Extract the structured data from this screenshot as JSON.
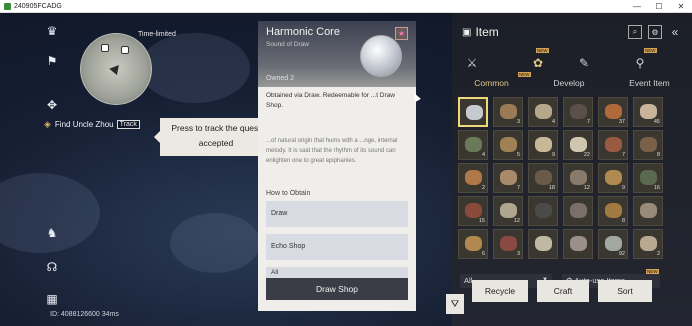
{
  "window": {
    "title": "240905FCADG",
    "min": "—",
    "max": "☐",
    "close": "✕"
  },
  "hud": {
    "time_limited": "Time-limited",
    "quest_name": "Find Uncle Zhou",
    "track_label": "Track",
    "tooltip": "Press to track the quest accepted",
    "id_text": "ID: 4088126600",
    "ping_text": "34ms"
  },
  "item_card": {
    "name": "Harmonic Core",
    "subtitle": "Sound of Draw",
    "owned": "Owned 2",
    "description": "Obtained via Draw. Redeemable for ...t Draw Shop.",
    "lore": "...of natural origin that hums with a ...nge, internal melody. It is said that the rhythm of its sound can enlighten one to great epiphanies.",
    "how_to_obtain": "How to Obtain",
    "sources": [
      "Draw",
      "Echo Shop",
      "All"
    ],
    "draw_shop_button": "Draw Shop"
  },
  "inventory": {
    "title": "Item",
    "subtabs": [
      "Common",
      "Develop",
      "Event Item"
    ],
    "active_subtab": "Common",
    "new_badge": "NEW",
    "filter_value": "All",
    "auto_use_label": "Auto-use Items",
    "buttons": {
      "recycle": "Recycle",
      "craft": "Craft",
      "sort": "Sort"
    },
    "slots": [
      {
        "count": "",
        "color": "#c7c9d0"
      },
      {
        "count": "3",
        "color": "#9a7b55"
      },
      {
        "count": "4",
        "color": "#b5a88a"
      },
      {
        "count": "7",
        "color": "#5a5048"
      },
      {
        "count": "37",
        "color": "#b06a3a"
      },
      {
        "count": "45",
        "color": "#c9b39a"
      },
      {
        "count": "4",
        "color": "#6a7a58"
      },
      {
        "count": "5",
        "color": "#a08055"
      },
      {
        "count": "9",
        "color": "#c8b898"
      },
      {
        "count": "22",
        "color": "#d0c6b0"
      },
      {
        "count": "7",
        "color": "#9a5a40"
      },
      {
        "count": "8",
        "color": "#7a6048"
      },
      {
        "count": "2",
        "color": "#b07848"
      },
      {
        "count": "7",
        "color": "#a88a6a"
      },
      {
        "count": "18",
        "color": "#6a5a4a"
      },
      {
        "count": "12",
        "color": "#8a7a6a"
      },
      {
        "count": "9",
        "color": "#b08a50"
      },
      {
        "count": "16",
        "color": "#5a6a50"
      },
      {
        "count": "15",
        "color": "#8a4a3a"
      },
      {
        "count": "12",
        "color": "#b0a58e"
      },
      {
        "count": "",
        "color": "#4a4a48"
      },
      {
        "count": "",
        "color": "#7a7068"
      },
      {
        "count": "8",
        "color": "#a07a40"
      },
      {
        "count": "",
        "color": "#9a8a78"
      },
      {
        "count": "6",
        "color": "#b08850"
      },
      {
        "count": "3",
        "color": "#8a4a42"
      },
      {
        "count": "",
        "color": "#c0b8a0"
      },
      {
        "count": "",
        "color": "#9a9088"
      },
      {
        "count": "92",
        "color": "#a0a8a0"
      },
      {
        "count": "2",
        "color": "#b8a890"
      }
    ]
  }
}
